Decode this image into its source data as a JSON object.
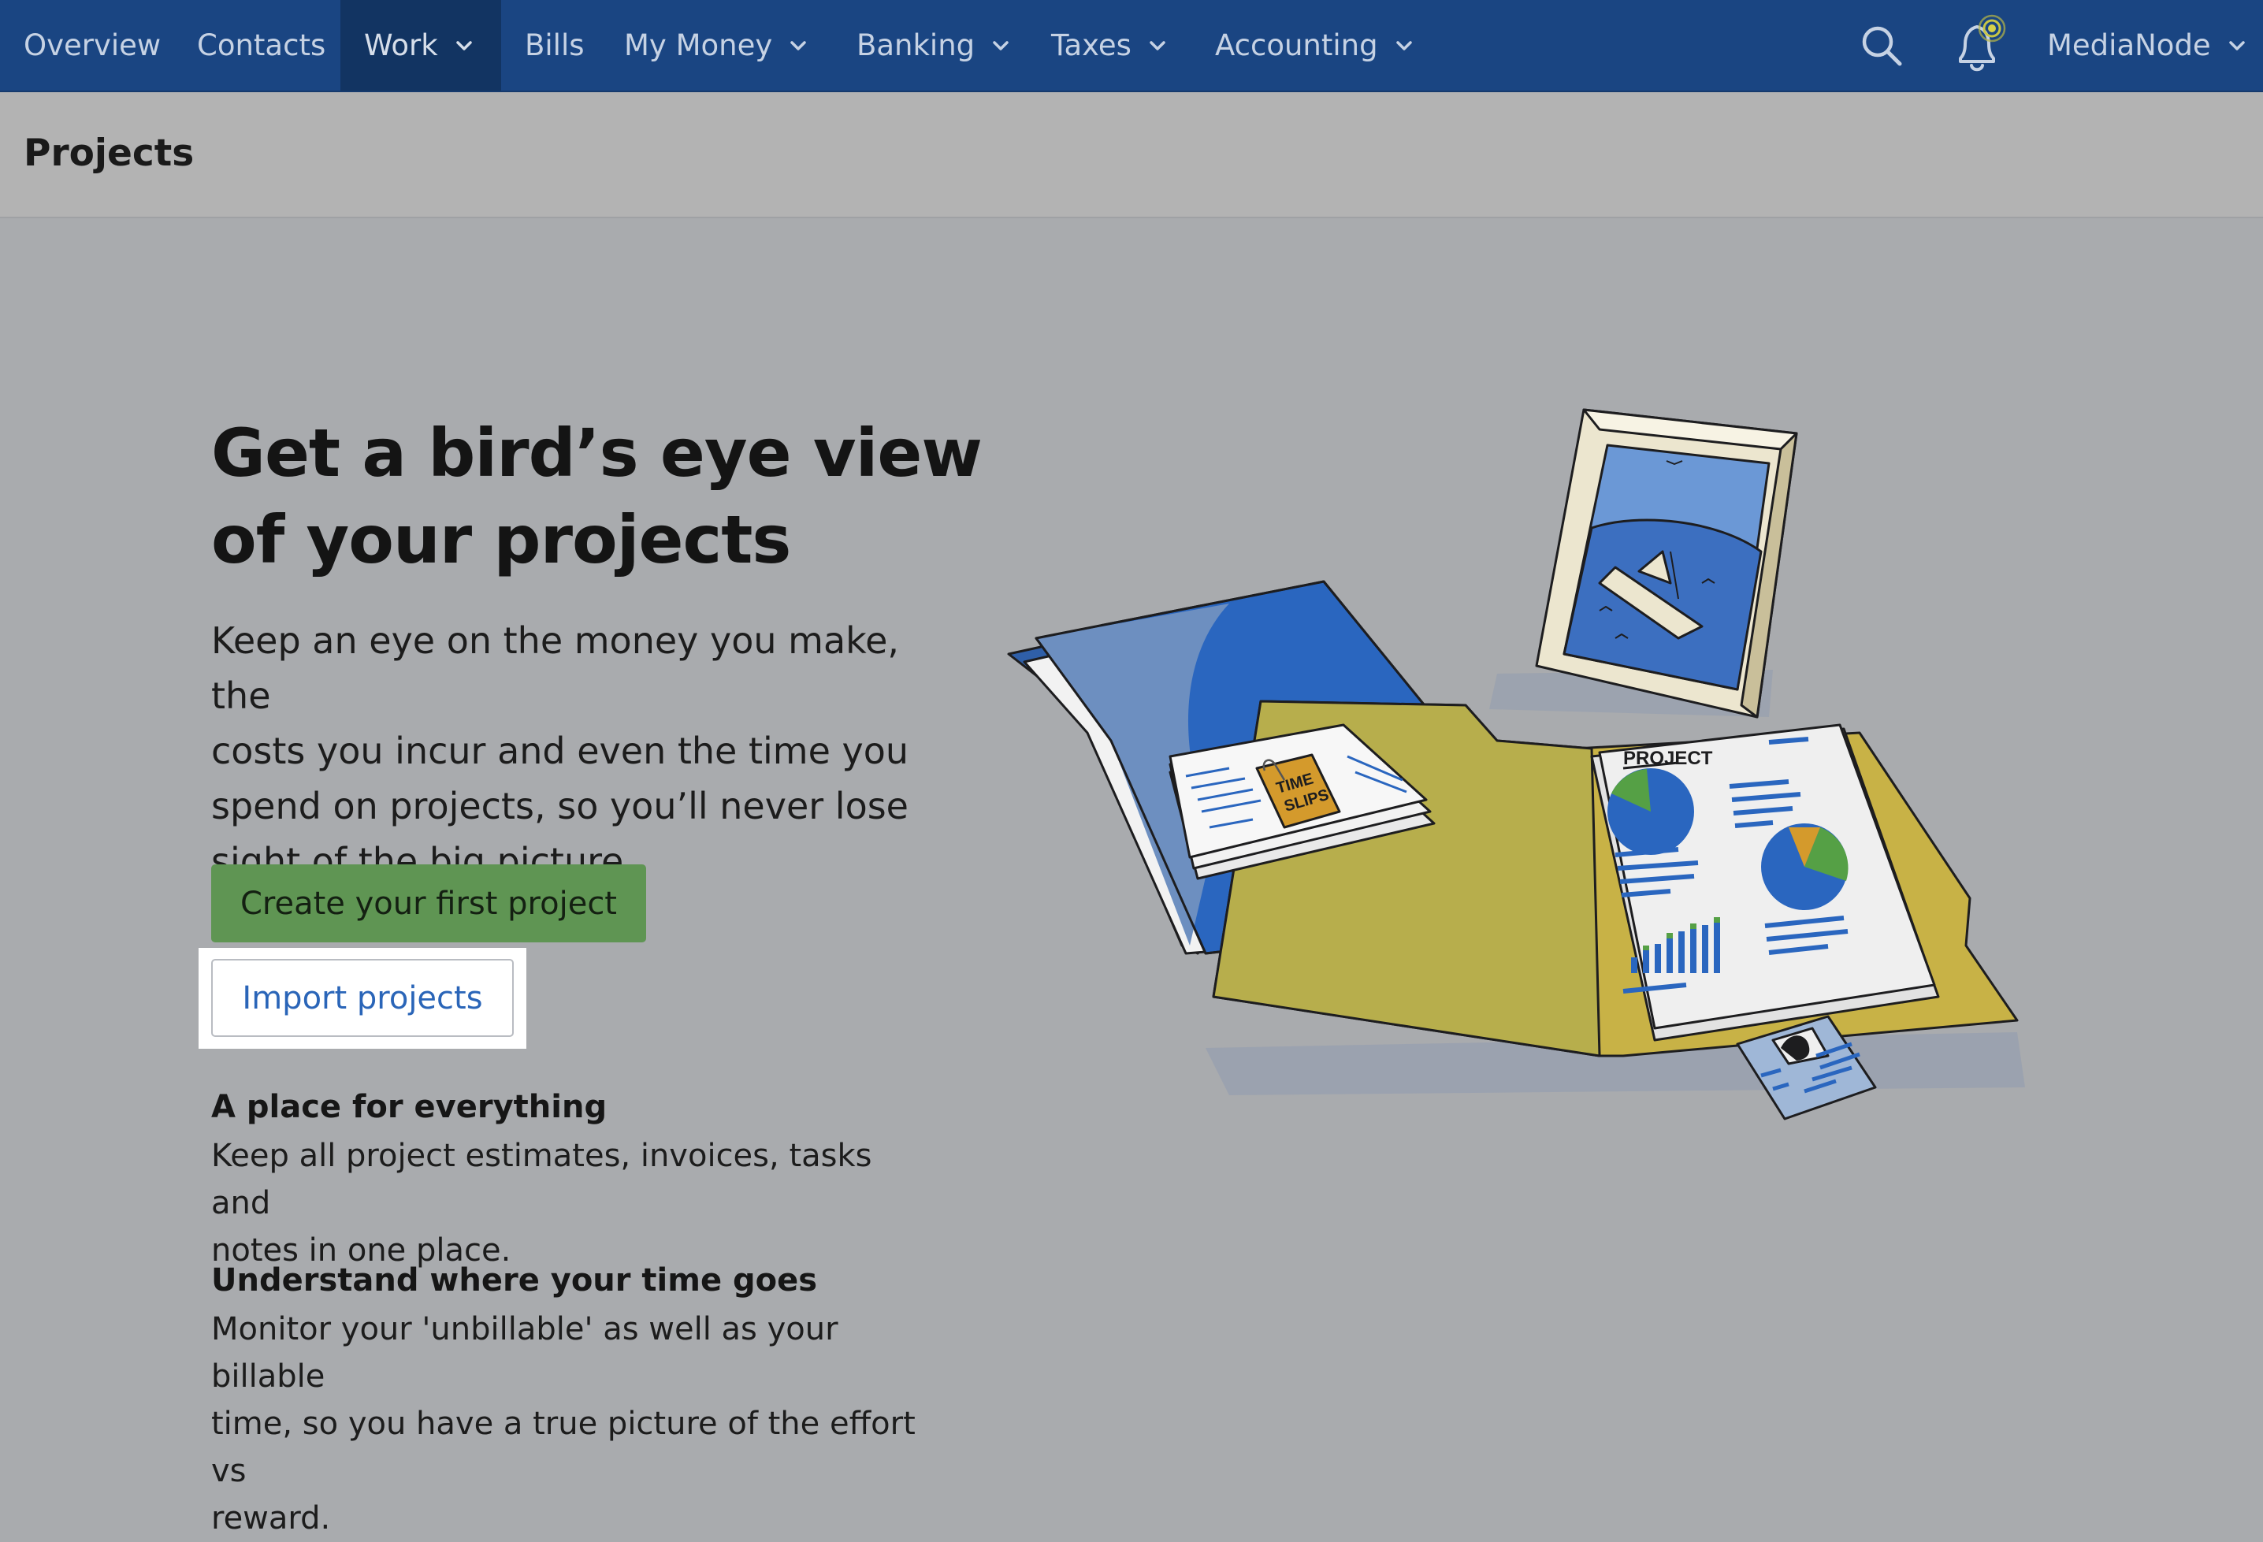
{
  "nav": {
    "items": [
      {
        "label": "Overview"
      },
      {
        "label": "Contacts"
      },
      {
        "label": "Work"
      },
      {
        "label": "Bills"
      },
      {
        "label": "My Money"
      },
      {
        "label": "Banking"
      },
      {
        "label": "Taxes"
      },
      {
        "label": "Accounting"
      }
    ],
    "active": "Work",
    "account_label": "MediaNode",
    "icons": {
      "search": "search-icon",
      "notifications": "bell-icon"
    }
  },
  "page": {
    "title": "Projects"
  },
  "hero": {
    "title_line1": "Get a bird’s eye view",
    "title_line2": "of your projects",
    "body_line1": "Keep an eye on the money you make, the",
    "body_line2": "costs you incur and even the time you",
    "body_line3": "spend on projects, so you’ll never lose",
    "body_line4": "sight of the big picture.",
    "primary_button": "Create your first project",
    "secondary_button": "Import projects"
  },
  "features": [
    {
      "title": "A place for everything",
      "text_line1": "Keep all project estimates, invoices, tasks and",
      "text_line2": "notes in one place."
    },
    {
      "title": "Understand where your time goes",
      "text_line1": "Monitor your 'unbillable' as well as your billable",
      "text_line2": "time, so you have a true picture of the effort vs",
      "text_line3": "reward."
    }
  ],
  "illustration": {
    "time_slips_line1": "TIME",
    "time_slips_line2": "SLIPS",
    "report_label": "PROJECT",
    "colors": {
      "blue_folder": "#2a66bf",
      "yellow_folder": "#c9b54a",
      "green": "#55a045",
      "orange": "#d49a2c"
    }
  }
}
